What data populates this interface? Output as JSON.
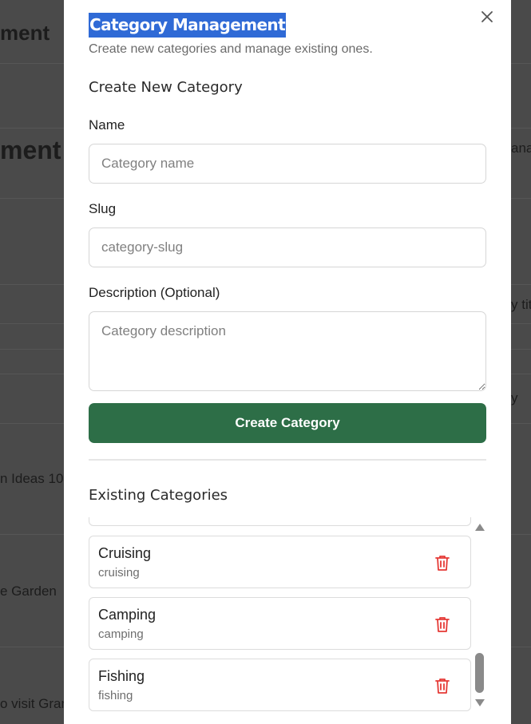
{
  "background": {
    "heading_top": "ment",
    "heading_mid": "ment",
    "right_snippet_1": "ana",
    "right_snippet_2": "y tit",
    "right_snippet_3": "y",
    "row_1": "n Ideas 10",
    "row_2": "e Garden",
    "row_3": "o visit Gran"
  },
  "modal": {
    "title": "Category Management",
    "subtitle": "Create new categories and manage existing ones.",
    "close_icon": "close-icon",
    "create_section": {
      "heading": "Create New Category",
      "name_label": "Name",
      "name_placeholder": "Category name",
      "name_value": "",
      "slug_label": "Slug",
      "slug_placeholder": "category-slug",
      "slug_value": "",
      "description_label": "Description (Optional)",
      "description_placeholder": "Category description",
      "description_value": "",
      "submit_label": "Create Category"
    },
    "existing_section": {
      "heading": "Existing Categories",
      "items": [
        {
          "name": "Cruising",
          "slug": "cruising"
        },
        {
          "name": "Camping",
          "slug": "camping"
        },
        {
          "name": "Fishing",
          "slug": "fishing"
        }
      ],
      "delete_icon": "trash-icon"
    }
  },
  "colors": {
    "primary_button": "#2d6e47",
    "delete_icon": "#e53935",
    "title_highlight": "#2f6ad6"
  }
}
